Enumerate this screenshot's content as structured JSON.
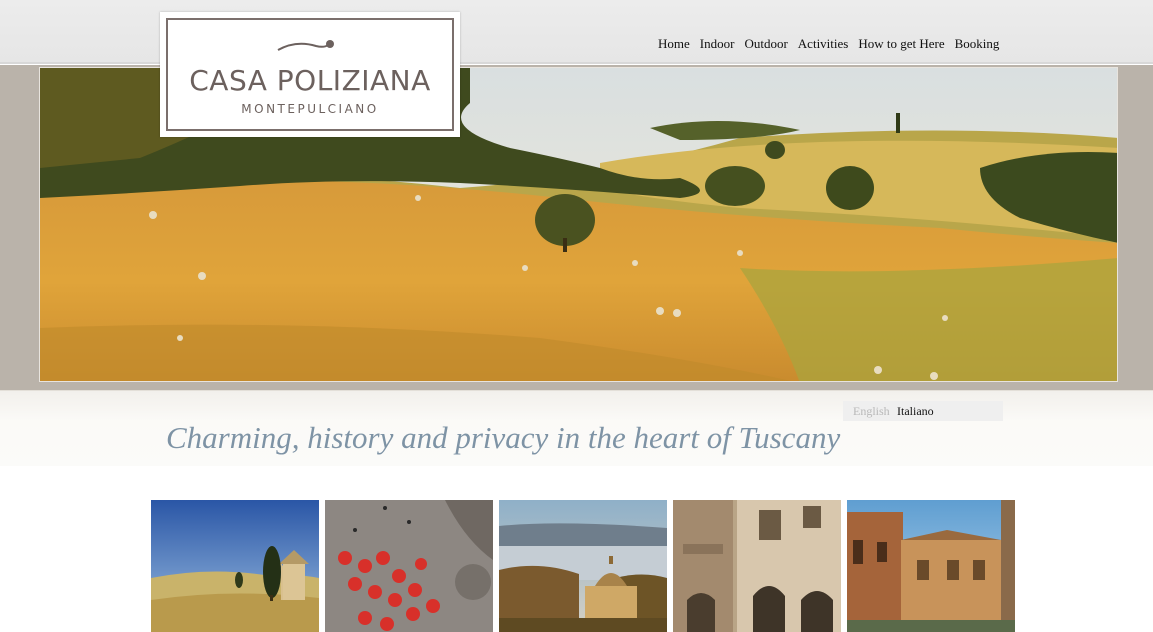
{
  "brand": {
    "name": "CASA POLIZIANA",
    "subtitle": "MONTEPULCIANO"
  },
  "nav": {
    "items": [
      {
        "label": "Home"
      },
      {
        "label": "Indoor"
      },
      {
        "label": "Outdoor"
      },
      {
        "label": "Activities"
      },
      {
        "label": "How to get Here"
      },
      {
        "label": "Booking"
      }
    ]
  },
  "language": {
    "english": "English",
    "italiano": "Italiano",
    "active": "English"
  },
  "tagline": "Charming, history and privacy in the heart of Tuscany",
  "hero": {
    "subject": "tuscan-hills-hay-bales-photo"
  },
  "gallery": [
    {
      "subject": "chapel-cypress-photo"
    },
    {
      "subject": "piazza-cafe-umbrellas-photo"
    },
    {
      "subject": "church-in-fog-valley-photo"
    },
    {
      "subject": "palazzo-arches-photo"
    },
    {
      "subject": "village-street-photo"
    }
  ],
  "colors": {
    "tagline": "#7e93a5",
    "logo": "#6c615e",
    "topbar": "#e8e8e8",
    "hero_frame": "#bab3aa"
  }
}
